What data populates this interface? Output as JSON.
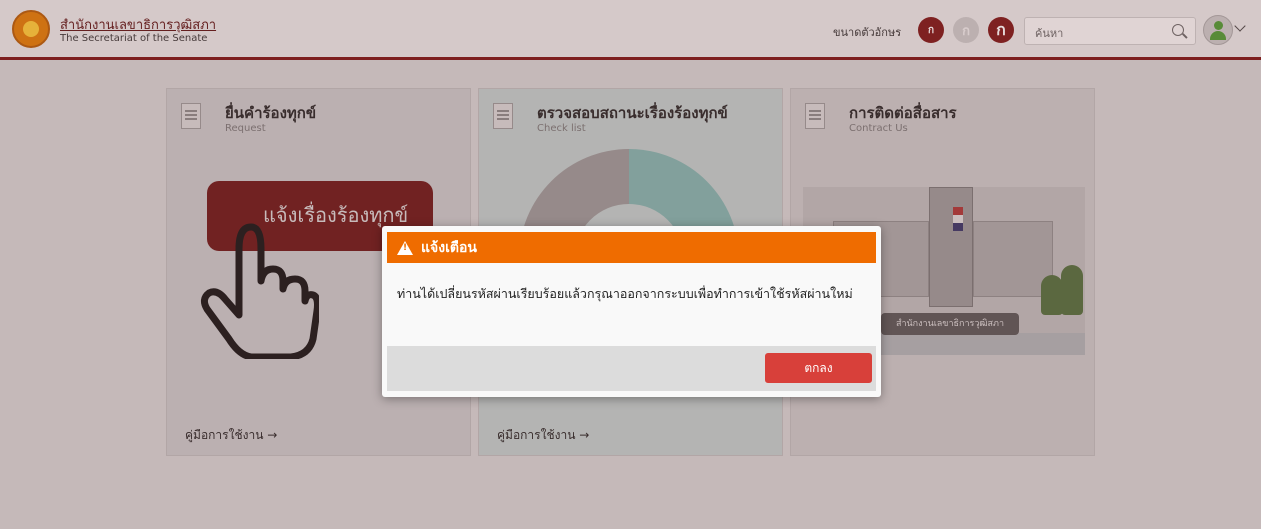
{
  "header": {
    "org_name_th": "สำนักงานเลขาธิการวุฒิสภา",
    "org_name_en": "The Secretariat of the Senate",
    "font_size_label": "ขนาดตัวอักษร",
    "font_buttons": [
      "ก",
      "ก",
      "ก"
    ],
    "search_placeholder": "ค้นหา"
  },
  "cards": [
    {
      "title": "ยื่นคำร้องทุกข์",
      "subtitle": "Request",
      "button_label": "แจ้งเรื่องร้องทุกข์",
      "manual_link": "คู่มือการใช้งาน →"
    },
    {
      "title": "ตรวจสอบสถานะเรื่องร้องทุกข์",
      "subtitle": "Check list",
      "manual_link": "คู่มือการใช้งาน →"
    },
    {
      "title": "การติดต่อสื่อสาร",
      "subtitle": "Contract Us",
      "image_sign": "สำนักงานเลขาธิการวุฒิสภา"
    }
  ],
  "dialog": {
    "title": "แจ้งเตือน",
    "message": "ท่านได้เปลี่ยนรหัสผ่านเรียบร้อยแล้วกรุณาออกจากระบบเพื่อทำการเข้าใช้รหัสผ่านใหม่",
    "ok_label": "ตกลง"
  },
  "colors": {
    "brand": "#7a1212",
    "dialog_header": "#ef6c00",
    "ok_button": "#d8403a"
  }
}
